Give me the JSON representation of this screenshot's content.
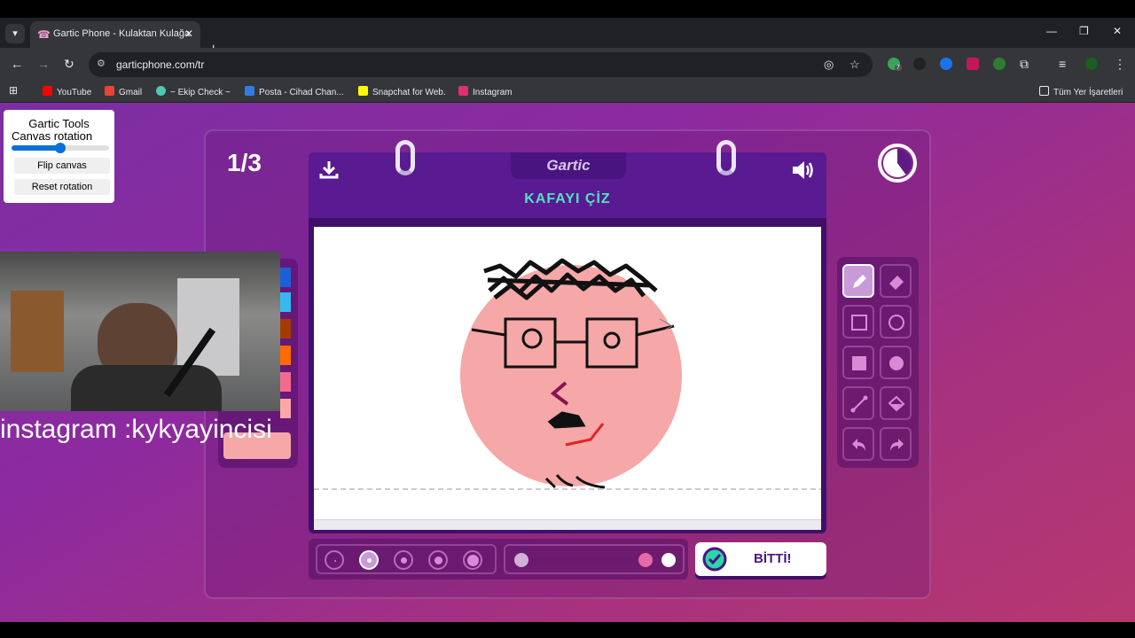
{
  "browser": {
    "tab_title": "Gartic Phone - Kulaktan Kulağa",
    "url": "garticphone.com/tr",
    "bookmarks": [
      {
        "label": "YouTube",
        "color": "#ff0000"
      },
      {
        "label": "Gmail",
        "color": "#ea4335"
      },
      {
        "label": "~ Ekip Check ~",
        "color": "#4ec9b0"
      },
      {
        "label": "Posta - Cihad Chan...",
        "color": "#2f7de1"
      },
      {
        "label": "Snapchat for Web.",
        "color": "#fffc00"
      },
      {
        "label": "Instagram",
        "color": "#e1306c"
      }
    ],
    "all_bookmarks": "Tüm Yer İşaretleri",
    "extension_badge": "7"
  },
  "game": {
    "round_counter": "1/3",
    "logo": "Gartic",
    "prompt": "KAFAYI ÇİZ",
    "done_label": "BİTTİ!",
    "active_tool": "pencil",
    "tools": [
      "pencil",
      "eraser",
      "rectangle-outline",
      "ellipse-outline",
      "rectangle-filled",
      "ellipse-filled",
      "line",
      "bucket",
      "undo",
      "redo"
    ],
    "brush_sizes": 5,
    "selected_size_index": 1,
    "palette_colors": [
      "#1d5fd6",
      "#37b9f0",
      "#a33c00",
      "#ff6a00",
      "#f36b8c",
      "#ffa7a7"
    ],
    "selected_color": "#f6a7a7",
    "timer_remaining_fraction": 0.6
  },
  "extension": {
    "title": "Gartic Tools",
    "rotation_label": "Canvas rotation",
    "rotation_value": 0.5,
    "flip_button": "Flip canvas",
    "reset_button": "Reset rotation"
  },
  "overlay": {
    "caption": "instagram :kykyayincisi"
  }
}
